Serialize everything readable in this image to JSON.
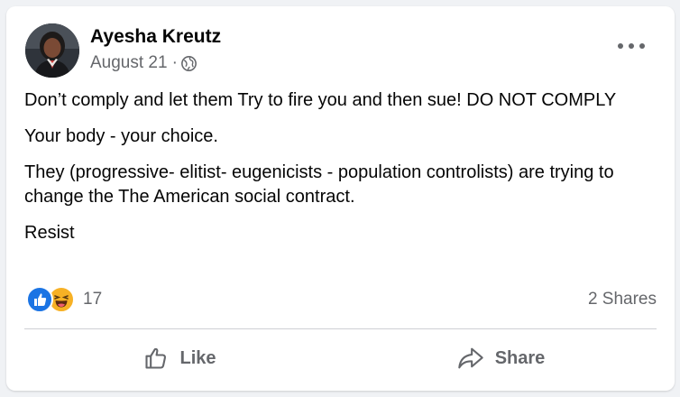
{
  "post": {
    "author": "Ayesha Kreutz",
    "date": "August 21",
    "separator": "·",
    "privacy_icon": "globe-icon",
    "more_icon": "more-options-icon",
    "paragraphs": [
      "Don’t comply and let them Try to fire you and then sue! DO NOT COMPLY",
      "Your body - your choice.",
      "They (progressive- elitist- eugenicists - population controlists) are trying to change the The American social contract.",
      "Resist"
    ]
  },
  "stats": {
    "reaction_icons": [
      "like-reaction-icon",
      "haha-reaction-icon"
    ],
    "reaction_count": "17",
    "shares": "2 Shares"
  },
  "actions": {
    "like_label": "Like",
    "like_icon": "thumbs-up-icon",
    "share_label": "Share",
    "share_icon": "share-arrow-icon"
  },
  "colors": {
    "like_blue": "#1b74e4",
    "haha_yellow": "#f7b125",
    "secondary_text": "#65676b",
    "page_background": "#f0f2f5"
  }
}
